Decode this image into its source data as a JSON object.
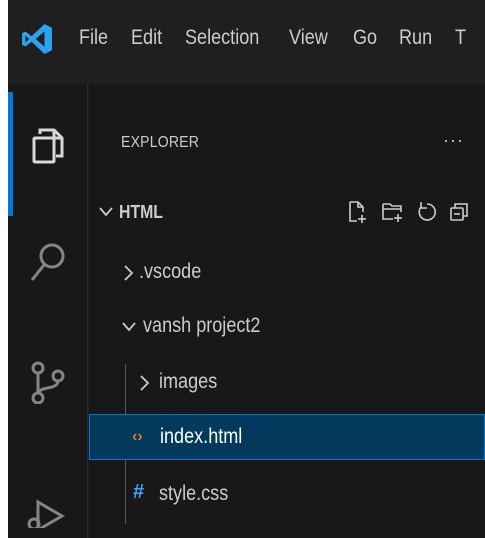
{
  "menubar": {
    "logo_icon": "vscode-logo",
    "items": [
      "File",
      "Edit",
      "Selection",
      "View",
      "Go",
      "Run",
      "T"
    ]
  },
  "activitybar": {
    "items": [
      {
        "name": "explorer",
        "icon": "files-icon",
        "active": true
      },
      {
        "name": "search",
        "icon": "search-icon",
        "active": false
      },
      {
        "name": "source-control",
        "icon": "source-control-icon",
        "active": false
      },
      {
        "name": "run-debug",
        "icon": "run-debug-icon",
        "active": false
      }
    ]
  },
  "sidebar": {
    "title": "EXPLORER",
    "more": "···",
    "section": {
      "name": "HTML",
      "actions": [
        "new-file-icon",
        "new-folder-icon",
        "refresh-icon",
        "collapse-all-icon"
      ]
    },
    "tree": [
      {
        "label": ".vscode",
        "type": "folder",
        "expanded": false,
        "depth": 0
      },
      {
        "label": "vansh project2",
        "type": "folder",
        "expanded": true,
        "depth": 0
      },
      {
        "label": "images",
        "type": "folder",
        "expanded": false,
        "depth": 1
      },
      {
        "label": "index.html",
        "type": "file",
        "fileIcon": "‹›",
        "depth": 1,
        "selected": true
      },
      {
        "label": "style.css",
        "type": "file",
        "fileIcon": "#",
        "depth": 1
      }
    ]
  },
  "colors": {
    "accent": "#0078d4",
    "selection_bg": "#04395e",
    "html_icon": "#e37933",
    "css_icon": "#42a5f5"
  }
}
